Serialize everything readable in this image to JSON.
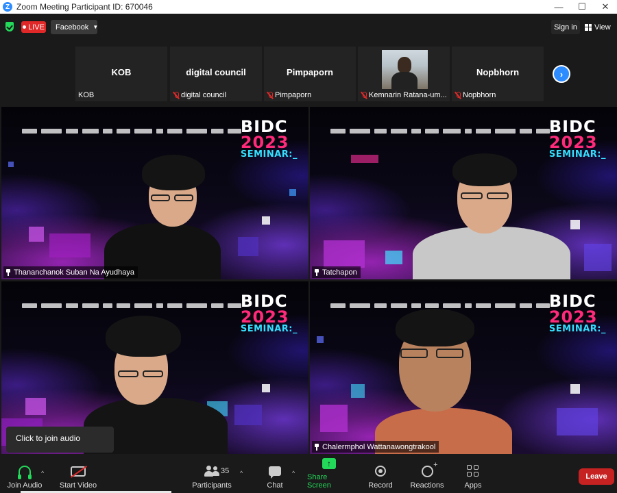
{
  "window": {
    "title": "Zoom Meeting Participant ID: 670046",
    "minimize": "—",
    "maximize": "☐",
    "close": "✕"
  },
  "topbar": {
    "live_label": "LIVE",
    "stream_target": "Facebook",
    "signin_label": "Sign in",
    "view_label": "View",
    "colors": {
      "secure": "#23d959",
      "live": "#e02828"
    }
  },
  "thumbnails": [
    {
      "display_name": "KOB",
      "label": "KOB",
      "muted": false
    },
    {
      "display_name": "digital council",
      "label": "digital council",
      "muted": true
    },
    {
      "display_name": "Pimpaporn",
      "label": "Pimpaporn",
      "muted": true
    },
    {
      "display_name": "",
      "label": "Kemnarin Ratana-um...",
      "muted": true,
      "has_video": true
    },
    {
      "display_name": "Nopbhorn",
      "label": "Nopbhorn",
      "muted": true
    }
  ],
  "event_banner": {
    "line1": "BIDC",
    "line2": "2023",
    "line3": "SEMINAR:_"
  },
  "tiles": [
    {
      "name": "Thananchanok Suban Na Ayudhaya",
      "active_speaker": true
    },
    {
      "name": "Tatchapon",
      "active_speaker": false
    },
    {
      "name": "",
      "active_speaker": false
    },
    {
      "name": "Chalermphol Wattanawongtrakool",
      "active_speaker": false
    }
  ],
  "tooltip": {
    "text": "Click to join audio"
  },
  "toolbar": {
    "join_audio": "Join Audio",
    "start_video": "Start Video",
    "participants": "Participants",
    "participant_count": "35",
    "chat": "Chat",
    "share_screen": "Share Screen",
    "record": "Record",
    "reactions": "Reactions",
    "apps": "Apps",
    "leave": "Leave",
    "colors": {
      "share": "#23d959",
      "leave": "#c72222",
      "active_outline": "#e8f07a"
    }
  }
}
